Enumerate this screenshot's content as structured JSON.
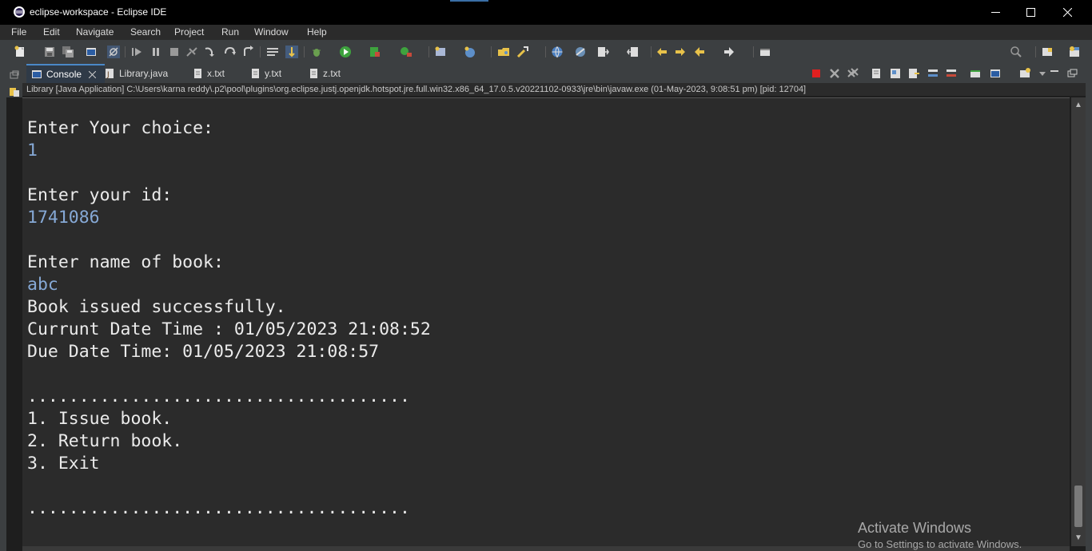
{
  "window": {
    "title": "eclipse-workspace - Eclipse IDE",
    "controls": [
      "minimize",
      "maximize",
      "close"
    ]
  },
  "menu": {
    "items": [
      {
        "label": "File"
      },
      {
        "label": "Edit"
      },
      {
        "label": "Navigate"
      },
      {
        "label": "Search"
      },
      {
        "label": "Project"
      },
      {
        "label": "Run"
      },
      {
        "label": "Window"
      },
      {
        "label": "Help"
      }
    ]
  },
  "toolbar": {
    "icons": [
      "new-icon",
      "save-icon",
      "save-all-icon",
      "terminal-icon",
      "skip-breakpoints-icon",
      "resume-icon",
      "suspend-icon",
      "terminate-icon",
      "disconnect-icon",
      "step-into-icon",
      "step-over-icon",
      "step-return-icon",
      "word-wrap-icon",
      "scroll-lock-icon",
      "debug-icon",
      "run-icon",
      "coverage-icon",
      "external-tools-icon",
      "new-java-project-icon",
      "new-class-icon",
      "open-type-icon",
      "search-task-icon",
      "globe-icon",
      "web-browser-icon",
      "annotation-next-icon",
      "annotation-prev-icon",
      "last-edit-icon",
      "back-icon",
      "forward-icon",
      "open-perspective-icon",
      "search-icon",
      "perspective-icon",
      "java-perspective-icon"
    ]
  },
  "tabs": [
    {
      "label": "Console",
      "active": true
    },
    {
      "label": "Library.java",
      "active": false
    },
    {
      "label": "x.txt",
      "active": false
    },
    {
      "label": "y.txt",
      "active": false
    },
    {
      "label": "z.txt",
      "active": false
    }
  ],
  "console": {
    "process_info": "Library [Java Application] C:\\Users\\karna reddy\\.p2\\pool\\plugins\\org.eclipse.justj.openjdk.hotspot.jre.full.win32.x86_64_17.0.5.v20221102-0933\\jre\\bin\\javaw.exe  (01-May-2023, 9:08:51 pm) [pid: 12704]",
    "lines": [
      {
        "text": "Enter Your choice:",
        "input": false
      },
      {
        "text": "1",
        "input": true
      },
      {
        "text": "",
        "input": false
      },
      {
        "text": "Enter your id:",
        "input": false
      },
      {
        "text": "1741086",
        "input": true
      },
      {
        "text": "",
        "input": false
      },
      {
        "text": "Enter name of book:",
        "input": false
      },
      {
        "text": "abc",
        "input": true
      },
      {
        "text": "Book issued successfully.",
        "input": false
      },
      {
        "text": "Currunt Date Time : 01/05/2023 21:08:52",
        "input": false
      },
      {
        "text": "Due Date Time: 01/05/2023 21:08:57",
        "input": false
      },
      {
        "text": "",
        "input": false
      },
      {
        "text": ".....................................",
        "input": false
      },
      {
        "text": "1. Issue book.",
        "input": false
      },
      {
        "text": "2. Return book.",
        "input": false
      },
      {
        "text": "3. Exit",
        "input": false
      },
      {
        "text": "",
        "input": false
      },
      {
        "text": ".....................................",
        "input": false
      }
    ]
  },
  "watermark": {
    "line1": "Activate Windows",
    "line2": "Go to Settings to activate Windows."
  },
  "colors": {
    "console_bg": "#2b2b2b",
    "console_text": "#ebebeb",
    "input_text": "#86a9d6",
    "toolbar_bg": "#3c3f41",
    "titlebar_bg": "#000000"
  }
}
